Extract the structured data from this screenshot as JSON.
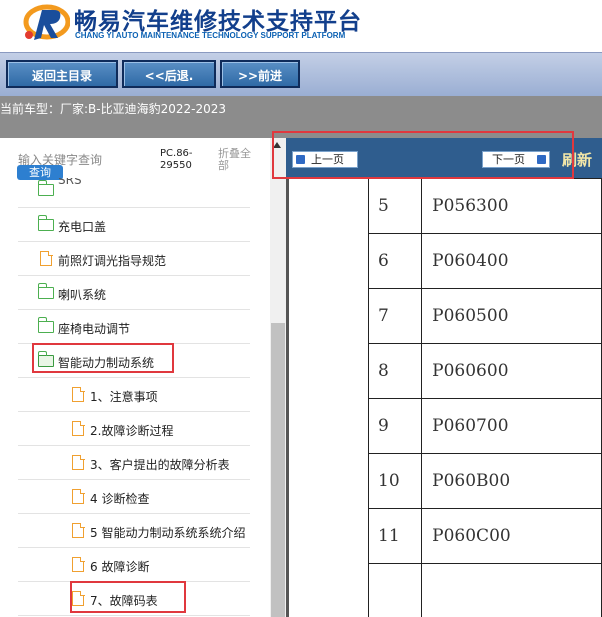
{
  "header": {
    "title_cn": "畅易汽车维修技术支持平台",
    "title_en": "CHANG YI AUTO MAINTENANCE TECHNOLOGY SUPPORT PLATFORM"
  },
  "toolbar": {
    "home_label": "返回主目录",
    "back_label": "<<后退.",
    "forward_label": ">>前进"
  },
  "info": {
    "car_model": "当前车型：厂家:B-比亚迪海豹2022-2023"
  },
  "sidebar": {
    "search_placeholder": "输入关键字查询",
    "search_button": "查询",
    "pc_code": "PC.86-29550",
    "collapse_all": "折叠全部",
    "partial_item": "SRS",
    "items": [
      {
        "label": "充电口盖",
        "icon": "folder-icon"
      },
      {
        "label": "前照灯调光指导规范",
        "icon": "document-icon"
      },
      {
        "label": "喇叭系统",
        "icon": "folder-icon"
      },
      {
        "label": "座椅电动调节",
        "icon": "folder-icon"
      },
      {
        "label": "智能动力制动系统",
        "icon": "folder-open-icon"
      },
      {
        "label": "1、注意事项",
        "icon": "document-icon"
      },
      {
        "label": "2.故障诊断过程",
        "icon": "document-icon"
      },
      {
        "label": "3、客户提出的故障分析表",
        "icon": "document-icon"
      },
      {
        "label": "4 诊断检查",
        "icon": "document-icon"
      },
      {
        "label": "5 智能动力制动系统系统介绍",
        "icon": "document-icon"
      },
      {
        "label": "6 故障诊断",
        "icon": "document-icon"
      },
      {
        "label": "7、故障码表",
        "icon": "document-icon"
      }
    ]
  },
  "content": {
    "prev_page": "上一页",
    "next_page": "下一页",
    "refresh": "刷新",
    "rows": [
      {
        "num": "5",
        "code": "P056300"
      },
      {
        "num": "6",
        "code": "P060400"
      },
      {
        "num": "7",
        "code": "P060500"
      },
      {
        "num": "8",
        "code": "P060600"
      },
      {
        "num": "9",
        "code": "P060700"
      },
      {
        "num": "10",
        "code": "P060B00"
      },
      {
        "num": "11",
        "code": "P060C00"
      },
      {
        "num": "",
        "code": ""
      }
    ]
  },
  "colors": {
    "title": "#123f8c",
    "nav_bar": "#2f5d8e",
    "highlight": "#e0383e",
    "toolbar_button": "#2f6aa6"
  }
}
